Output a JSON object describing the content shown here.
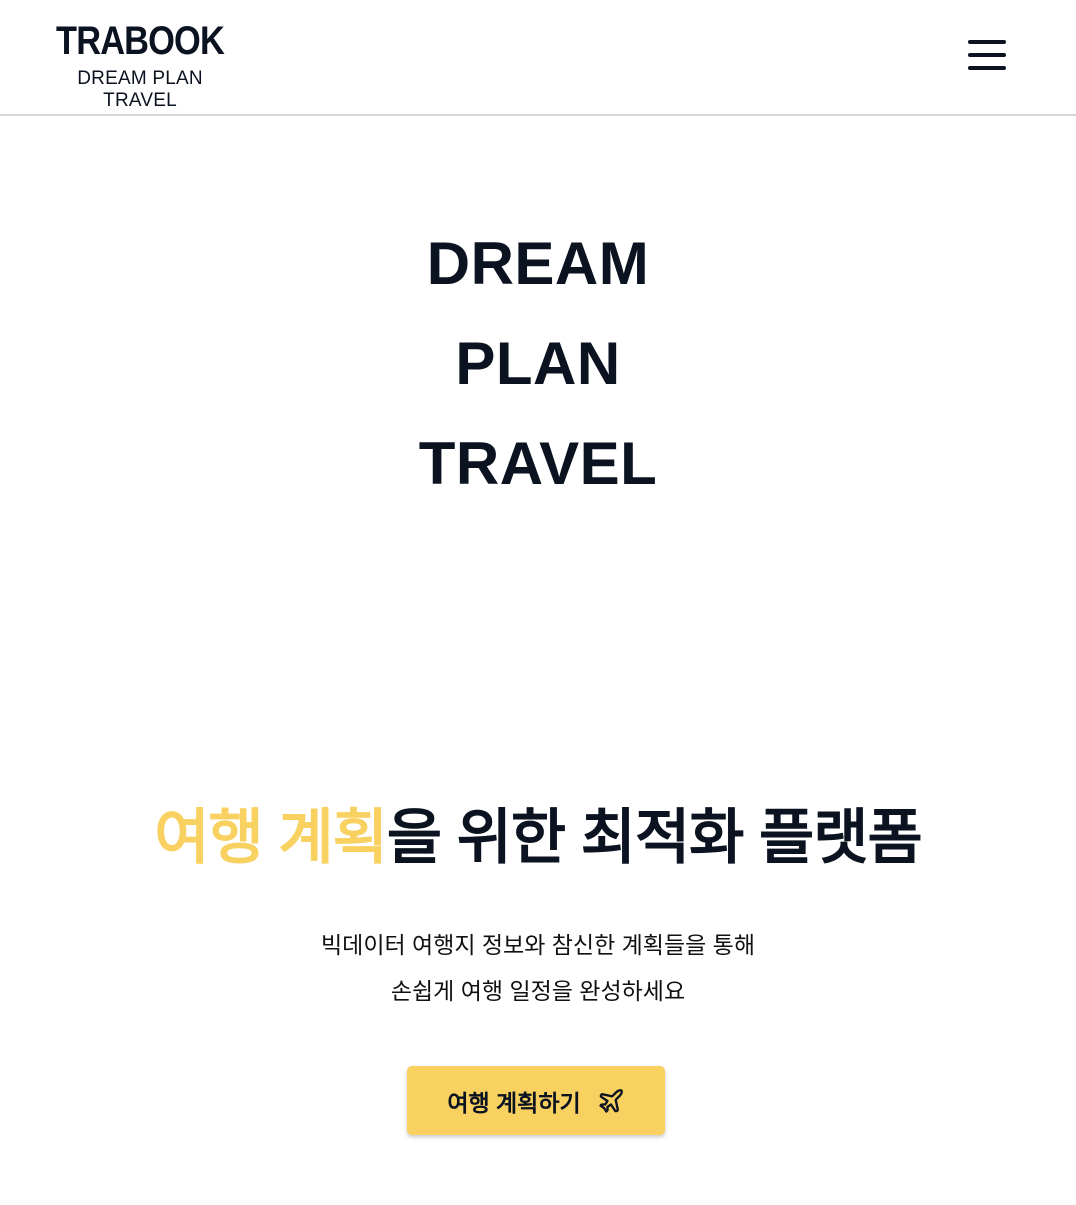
{
  "header": {
    "logo_title": "TRABOOK",
    "logo_subtitle": "DREAM PLAN TRAVEL",
    "menu_icon": "hamburger-menu-icon"
  },
  "hero": {
    "lines": [
      "DREAM",
      "PLAN",
      "TRAVEL"
    ]
  },
  "headline": {
    "accent_text": "여행 계획",
    "rest_text": "을 위한 최적화 플랫폼"
  },
  "description": {
    "line1": "빅데이터 여행지 정보와 참신한 계획들을 통해",
    "line2": "손쉽게 여행 일정을 완성하세요"
  },
  "cta": {
    "label": "여행 계획하기",
    "icon": "airplane-icon"
  },
  "colors": {
    "accent": "#f8d160",
    "text": "#0b1220",
    "divider": "#d6d6d6"
  }
}
